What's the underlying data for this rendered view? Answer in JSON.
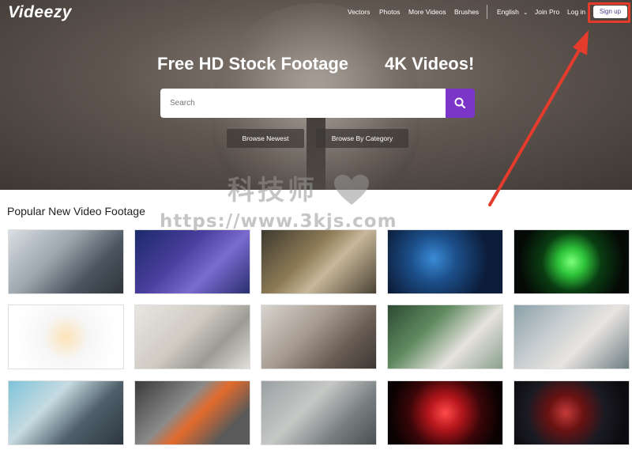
{
  "header": {
    "logo": "Videezy",
    "nav": [
      "Vectors",
      "Photos",
      "More Videos",
      "Brushes"
    ],
    "language": "English",
    "join_pro": "Join Pro",
    "login": "Log in",
    "signup": "Sign up"
  },
  "hero": {
    "title_left": "Free HD Stock Footage",
    "title_right": "4K Videos!",
    "search_placeholder": "Search",
    "browse_newest": "Browse Newest",
    "browse_category": "Browse By Category"
  },
  "section": {
    "title": "Popular New Video Footage"
  },
  "watermark": {
    "brand": "科技师",
    "url": "https://www.3kjs.com"
  },
  "colors": {
    "accent": "#7b35c8",
    "highlight": "#e53b2c"
  }
}
